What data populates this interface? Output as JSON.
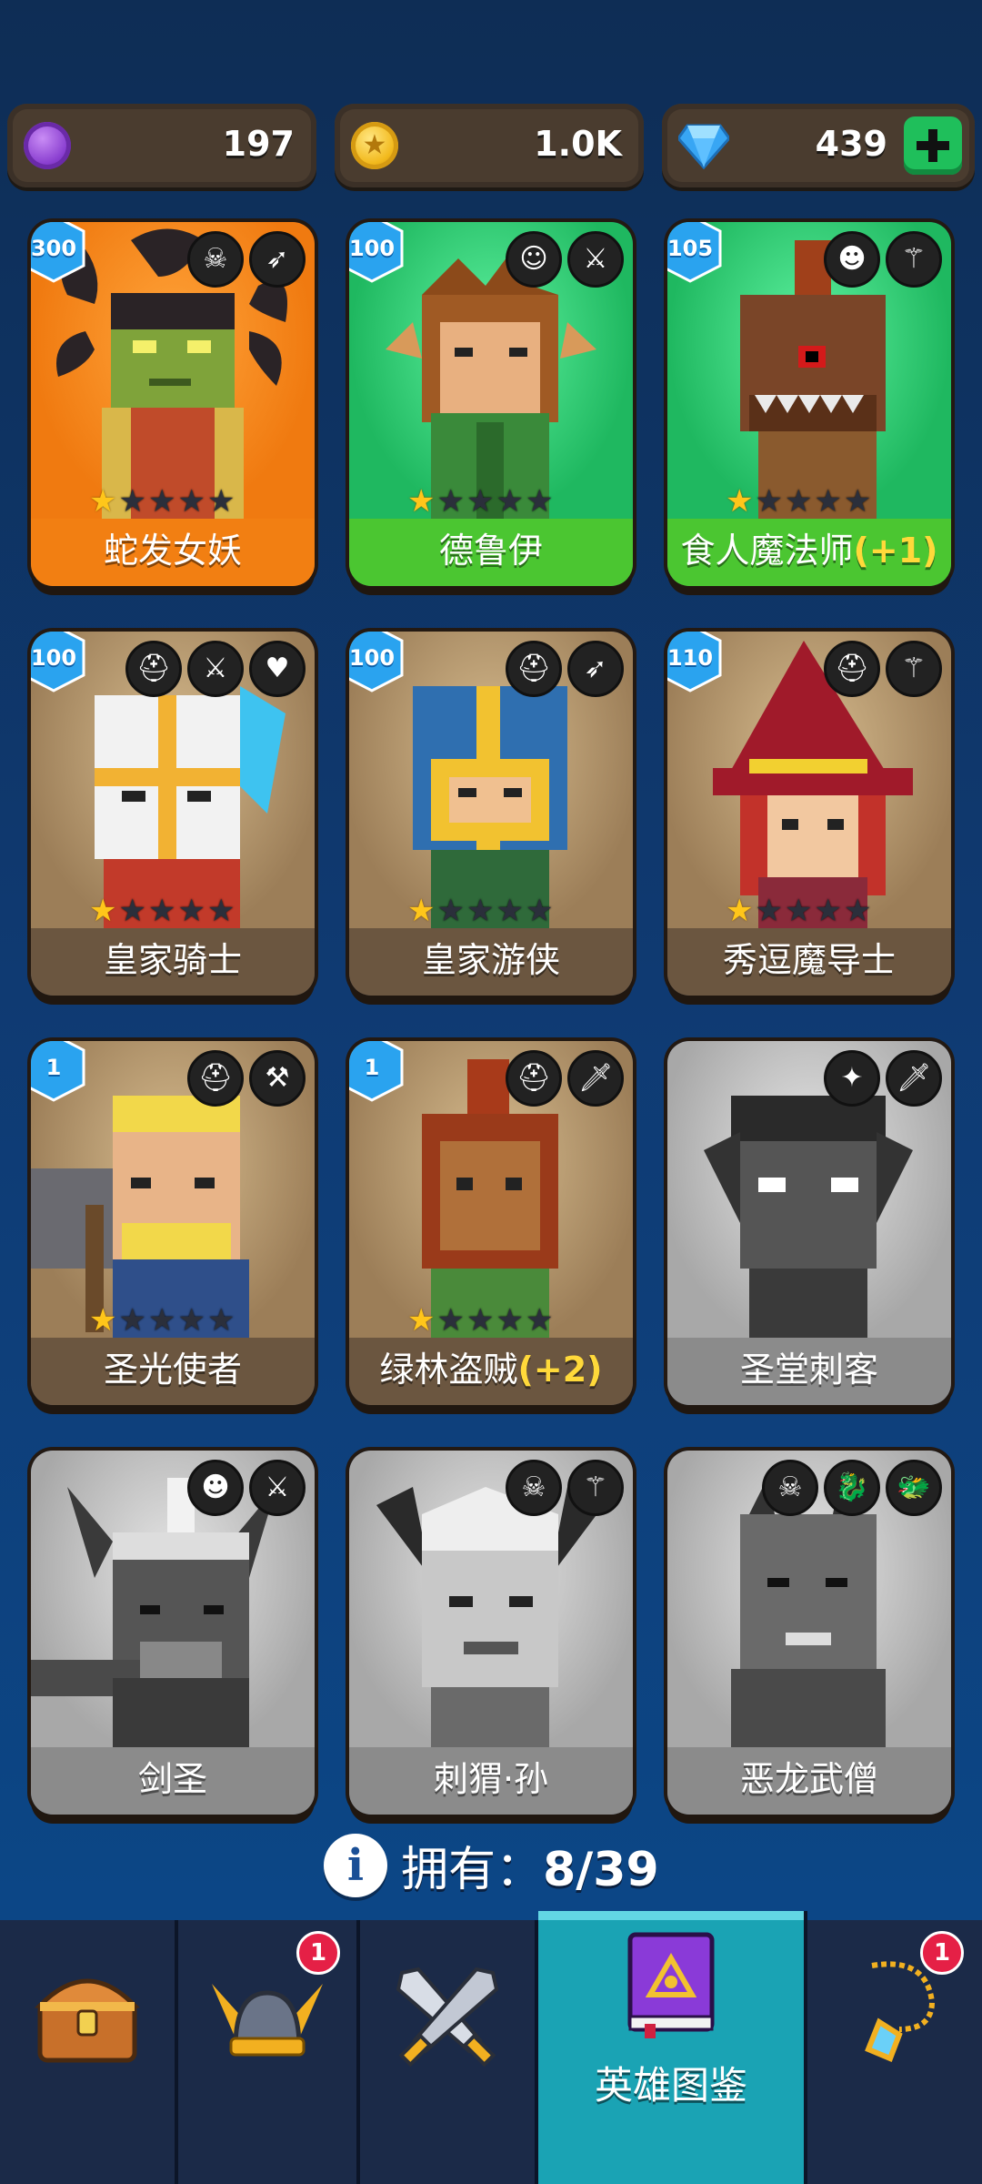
{
  "currencies": [
    {
      "name": "purple-token",
      "value": "197",
      "color": "#9b4ad8"
    },
    {
      "name": "gold-coin",
      "value": "1.0K",
      "color": "#f2c22a"
    },
    {
      "name": "gem",
      "value": "439",
      "color": "#3aa7f5"
    }
  ],
  "heroes": [
    {
      "name": "蛇发女妖",
      "level": "300",
      "stars": 1,
      "bonus": "",
      "owned": true,
      "theme": "orange",
      "name_bg": "#f27f12",
      "icons": [
        "orc-skull-icon",
        "bow-icon"
      ]
    },
    {
      "name": "德鲁伊",
      "level": "100",
      "stars": 1,
      "bonus": "",
      "owned": true,
      "theme": "green",
      "name_bg": "#4bc631",
      "icons": [
        "elf-face-icon",
        "sword-icon"
      ]
    },
    {
      "name": "食人魔法师",
      "level": "105",
      "stars": 1,
      "bonus": "(+1)",
      "owned": true,
      "theme": "green",
      "name_bg": "#4bc631",
      "icons": [
        "ogre-face-icon",
        "staff-icon"
      ]
    },
    {
      "name": "皇家骑士",
      "level": "100",
      "stars": 1,
      "bonus": "",
      "owned": true,
      "theme": "tan",
      "name_bg": "#6b5640",
      "icons": [
        "helmet-icon",
        "sword-icon",
        "heart-icon"
      ]
    },
    {
      "name": "皇家游侠",
      "level": "100",
      "stars": 1,
      "bonus": "",
      "owned": true,
      "theme": "tan",
      "name_bg": "#6b5640",
      "icons": [
        "helmet-icon",
        "bow-icon"
      ]
    },
    {
      "name": "秀逗魔导士",
      "level": "110",
      "stars": 1,
      "bonus": "",
      "owned": true,
      "theme": "tan",
      "name_bg": "#6b5640",
      "icons": [
        "helmet-icon",
        "staff-icon"
      ]
    },
    {
      "name": "圣光使者",
      "level": "1",
      "stars": 1,
      "bonus": "",
      "owned": true,
      "theme": "tan",
      "name_bg": "#6b5640",
      "icons": [
        "helmet-icon",
        "hammer-icon"
      ]
    },
    {
      "name": "绿林盗贼",
      "level": "1",
      "stars": 1,
      "bonus": "(+2)",
      "owned": true,
      "theme": "tan",
      "name_bg": "#6b5640",
      "icons": [
        "helmet-icon",
        "dagger-icon"
      ]
    },
    {
      "name": "圣堂刺客",
      "level": "",
      "stars": 0,
      "bonus": "",
      "owned": false,
      "theme": "gray",
      "name_bg": "#8b8b8b",
      "icons": [
        "winged-emblem-icon",
        "dagger-icon"
      ]
    },
    {
      "name": "剑圣",
      "level": "",
      "stars": 0,
      "bonus": "",
      "owned": false,
      "theme": "gray",
      "name_bg": "#8b8b8b",
      "icons": [
        "ogre-face-icon",
        "sword-icon"
      ]
    },
    {
      "name": "刺猬·孙",
      "level": "",
      "stars": 0,
      "bonus": "",
      "owned": false,
      "theme": "gray",
      "name_bg": "#8b8b8b",
      "icons": [
        "orc-skull-icon",
        "staff-icon"
      ]
    },
    {
      "name": "恶龙武僧",
      "level": "",
      "stars": 0,
      "bonus": "",
      "owned": false,
      "theme": "gray",
      "name_bg": "#8b8b8b",
      "icons": [
        "orc-skull-icon",
        "dragon-icon",
        "dragon-head-icon"
      ]
    }
  ],
  "owned_summary": {
    "label": "拥有：",
    "count": "8/39"
  },
  "nav": [
    {
      "name": "treasure-chest",
      "label": "",
      "badge": ""
    },
    {
      "name": "viking-helmet",
      "label": "",
      "badge": "1"
    },
    {
      "name": "crossed-swords",
      "label": "",
      "badge": ""
    },
    {
      "name": "hero-codex-book",
      "label": "英雄图鉴",
      "badge": "",
      "active": true
    },
    {
      "name": "amulet",
      "label": "",
      "badge": "1"
    }
  ]
}
